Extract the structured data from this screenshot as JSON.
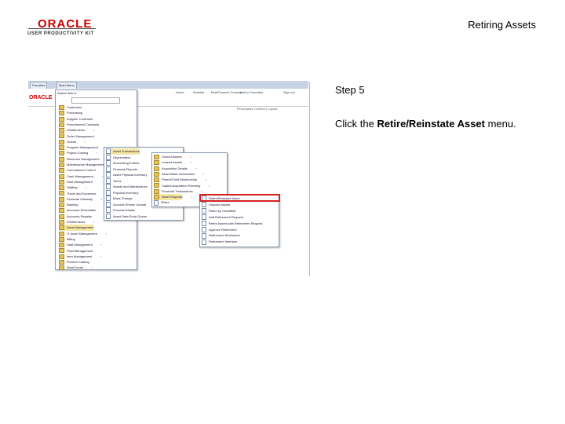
{
  "header": {
    "logo_main": "ORACLE",
    "logo_sub": "USER PRODUCTIVITY KIT",
    "doc_title": "Retiring Assets"
  },
  "step": {
    "label": "Step 5",
    "instruction_prefix": "Click the ",
    "instruction_target": "Retire/Reinstate Asset",
    "instruction_suffix": " menu."
  },
  "screenshot": {
    "favorites_tab": "Favorites",
    "main_menu_tab": "Main Menu",
    "search_label": "Search Menu:",
    "header_links": [
      "Home",
      "Worklist",
      "MultiChannel Console",
      "Add to Favorites",
      "Sign out"
    ],
    "personalize": "Personalize Content | Layout",
    "main_menu_items": [
      "Customers",
      "Purchasing",
      "Supplier Contracts",
      "Procurement Contracts",
      "eSettlements",
      "Order Management",
      "Grants",
      "Program Management",
      "Project Costing",
      "Resource Management",
      "Maintenance Management",
      "Commitment Control",
      "Cash Management",
      "Deal Management",
      "Staffing",
      "Travel and Expenses",
      "Financial Gateway",
      "Banking",
      "Accounts Receivable",
      "Accounts Payable",
      "eSettlements",
      "Asset Management",
      "IT Asset Management",
      "Billing",
      "Deal Management",
      "Fluid Management",
      "Item Management",
      "Product Catalog",
      "WorkCenter"
    ],
    "asset_mgmt_items": [
      "Asset Transactions",
      "Depreciation",
      "Accounting Entries",
      "Financial Reports",
      "Asset Physical Inventory",
      "Taxes",
      "Assets and Maintenance",
      "Physical Inventory",
      "Mass Change",
      "Account Entries Journal",
      "Process Details",
      "Asset Data Entry Queue"
    ],
    "asset_trans_items": [
      "Owned Assets",
      "Leased Assets",
      "Acquisition Details",
      "Asset Basic Information",
      "Parent/Child Relationship",
      "Capital Acquisition Planning",
      "Financial Transactions",
      "Asset Disposal",
      "Retire"
    ],
    "disposal_items": [
      "Retire/Reinstate Asset",
      "Dispose Assets",
      "Retire by Chartfield",
      "Add Retirement Request",
      "Retire Assets with Retirement Request",
      "Approve Retirement",
      "Retirement Worksheet",
      "Retirement Interface"
    ],
    "highlighted_item": "Retire/Reinstate Asset"
  }
}
